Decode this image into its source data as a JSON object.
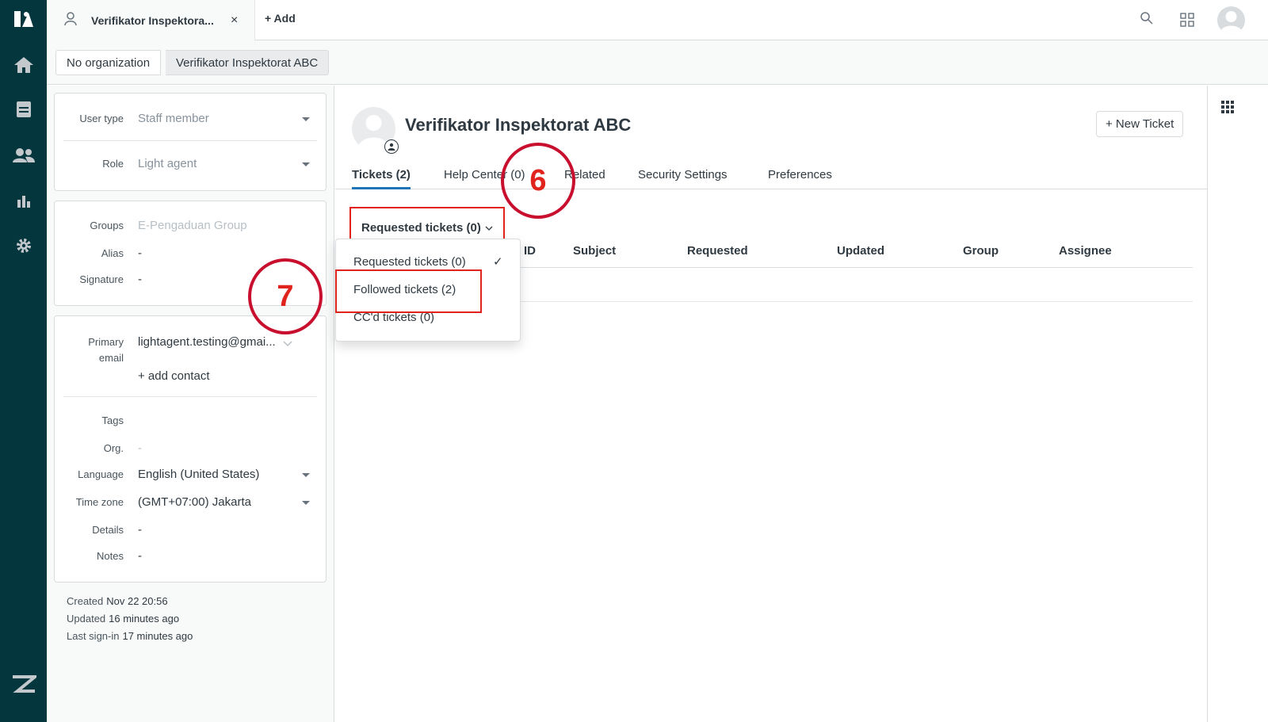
{
  "nav": {
    "items": [
      "home",
      "views",
      "customers",
      "reporting",
      "admin"
    ]
  },
  "topbar": {
    "tab_title": "Verifikator Inspektora...",
    "tab_close": "×",
    "add_label": "+ Add"
  },
  "breadcrumb": {
    "org": "No organization",
    "user": "Verifikator Inspektorat ABC"
  },
  "user_card": {
    "user_type_label": "User type",
    "user_type_value": "Staff member",
    "role_label": "Role",
    "role_value": "Light agent"
  },
  "groups_card": {
    "groups_label": "Groups",
    "groups_value": "E-Pengaduan Group",
    "alias_label": "Alias",
    "alias_value": "-",
    "signature_label": "Signature",
    "signature_value": "-"
  },
  "contact_card": {
    "primary_email_label_1": "Primary",
    "primary_email_label_2": "email",
    "primary_email_value": "lightagent.testing@gmai...",
    "add_contact": "+ add contact",
    "tags_label": "Tags",
    "org_label": "Org.",
    "org_value": "-",
    "language_label": "Language",
    "language_value": "English (United States)",
    "timezone_label": "Time zone",
    "timezone_value": "(GMT+07:00) Jakarta",
    "details_label": "Details",
    "details_value": "-",
    "notes_label": "Notes",
    "notes_value": "-"
  },
  "meta": {
    "created_label": "Created",
    "created_value": "Nov 22 20:56",
    "updated_label": "Updated",
    "updated_value": "16 minutes ago",
    "signin_label": "Last sign-in",
    "signin_value": "17 minutes ago"
  },
  "main": {
    "user_name": "Verifikator Inspektorat ABC",
    "new_ticket": "+ New Ticket",
    "tabs": [
      {
        "label": "Tickets (2)",
        "active": true
      },
      {
        "label": "Help Center (0)"
      },
      {
        "label": "Related"
      },
      {
        "label": "Security Settings"
      },
      {
        "label": "Preferences"
      }
    ],
    "ticket_filter": "Requested tickets (0)",
    "columns": [
      "ID",
      "Subject",
      "Requested",
      "Updated",
      "Group",
      "Assignee"
    ],
    "dropdown_items": [
      "Requested tickets (0)",
      "Followed tickets (2)",
      "CC'd tickets (0)"
    ],
    "check_mark": "✓"
  },
  "annotations": {
    "step6": "6",
    "step7": "7",
    "color": "#e0231d"
  }
}
